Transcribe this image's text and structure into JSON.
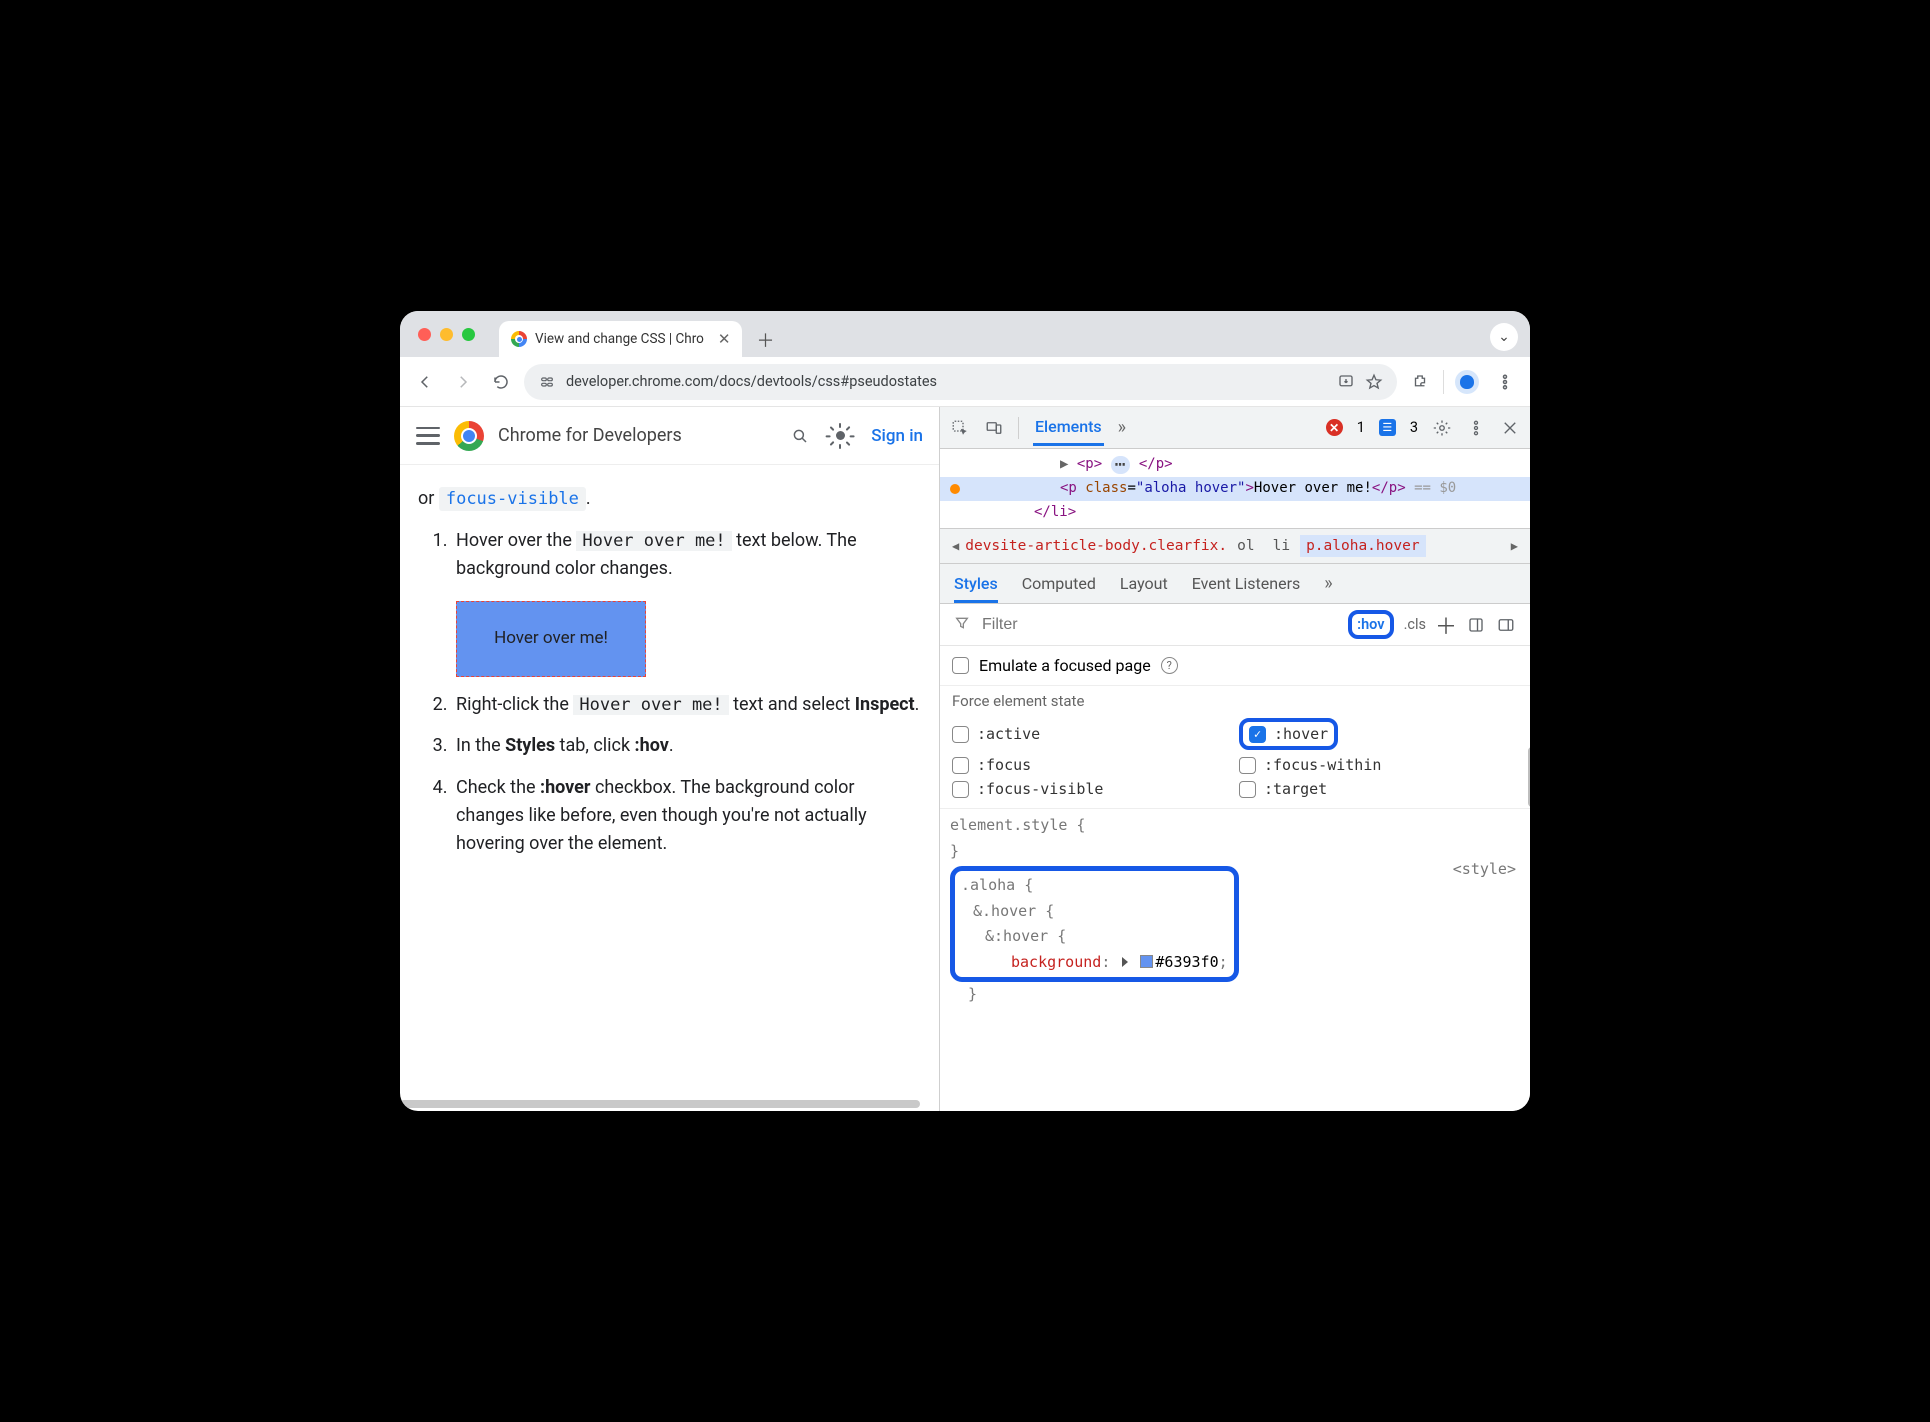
{
  "browser": {
    "tab_title": "View and change CSS  |  Chro",
    "url": "developer.chrome.com/docs/devtools/css#pseudostates"
  },
  "page": {
    "site_title": "Chrome for Developers",
    "sign_in": "Sign in",
    "intro_tail": "or ",
    "intro_code": "focus-visible",
    "period": ".",
    "steps": {
      "s1_a": "Hover over the ",
      "s1_code": "Hover over me!",
      "s1_b": " text below. The background color changes.",
      "hover_box": "Hover over me!",
      "s2_a": "Right-click the ",
      "s2_code": "Hover over me!",
      "s2_b": " text and select ",
      "s2_bold": "Inspect",
      "s3_a": "In the ",
      "s3_bold1": "Styles",
      "s3_b": " tab, click ",
      "s3_bold2": ":hov",
      "s4_a": "Check the ",
      "s4_bold": ":hover",
      "s4_b": " checkbox. The background color changes like before, even though you're not actually hovering over the element."
    }
  },
  "devtools": {
    "tab_elements": "Elements",
    "errors": "1",
    "issues": "3",
    "dom": {
      "p1_open": "<p>",
      "p1_close": "</p>",
      "p2": "<p class=\"aloha hover\">Hover over me!</p>",
      "eq0": " == $0",
      "li_close": "</li>"
    },
    "breadcrumb": {
      "b1": "devsite-article-body.clearfix.",
      "b2": "ol",
      "b3": "li",
      "b4": "p.aloha.hover"
    },
    "panes": {
      "styles": "Styles",
      "computed": "Computed",
      "layout": "Layout",
      "events": "Event Listeners"
    },
    "filter_placeholder": "Filter",
    "hov": ":hov",
    "cls": ".cls",
    "emulate": "Emulate a focused page",
    "force_title": "Force element state",
    "states": {
      "active": ":active",
      "hover": ":hover",
      "focus": ":focus",
      "focuswithin": ":focus-within",
      "focusvisible": ":focus-visible",
      "target": ":target"
    },
    "rules": {
      "elstyle": "element.style {",
      "aloha": ".aloha {",
      "andhover": "&.hover {",
      "andpsh": "&:hover {",
      "bgprop": "background",
      "bgval": "#6393f0",
      "src": "<style>"
    }
  }
}
